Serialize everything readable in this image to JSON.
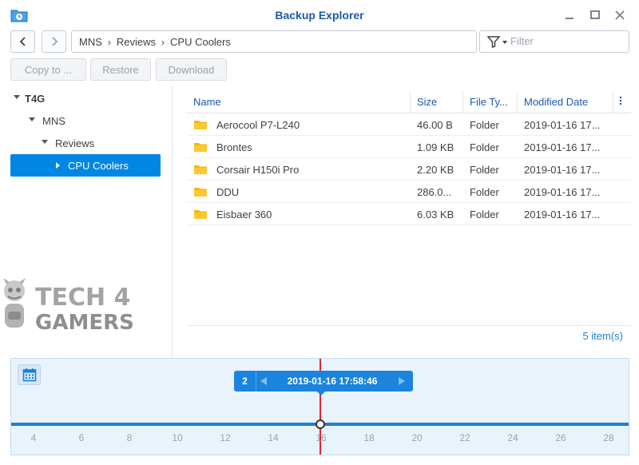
{
  "window": {
    "title": "Backup Explorer"
  },
  "colors": {
    "accent": "#0086e5",
    "title": "#1d5aa8",
    "cursor": "#e0242a",
    "folder": "#f5b70f"
  },
  "breadcrumb": [
    "MNS",
    "Reviews",
    "CPU Coolers"
  ],
  "filter": {
    "placeholder": "Filter"
  },
  "toolbar": {
    "copy_label": "Copy to ...",
    "restore_label": "Restore",
    "download_label": "Download"
  },
  "tree": [
    {
      "label": "T4G",
      "bold": true
    },
    {
      "label": "MNS"
    },
    {
      "label": "Reviews"
    },
    {
      "label": "CPU Coolers",
      "selected": true
    }
  ],
  "table": {
    "columns": [
      "Name",
      "Size",
      "File Ty...",
      "Modified Date"
    ],
    "rows": [
      {
        "name": "Aerocool P7-L240",
        "size": "46.00 B",
        "type": "Folder",
        "date": "2019-01-16 17..."
      },
      {
        "name": "Brontes",
        "size": "1.09 KB",
        "type": "Folder",
        "date": "2019-01-16 17..."
      },
      {
        "name": "Corsair H150i Pro",
        "size": "2.20 KB",
        "type": "Folder",
        "date": "2019-01-16 17..."
      },
      {
        "name": "DDU",
        "size": "286.0...",
        "type": "Folder",
        "date": "2019-01-16 17..."
      },
      {
        "name": "Eisbaer 360",
        "size": "6.03 KB",
        "type": "Folder",
        "date": "2019-01-16 17..."
      }
    ]
  },
  "status": {
    "items": "5 item(s)"
  },
  "timeline": {
    "version_count": "2",
    "current": "2019-01-16 17:58:46",
    "ticks": [
      "4",
      "6",
      "8",
      "10",
      "12",
      "14",
      "16",
      "18",
      "20",
      "22",
      "24",
      "26",
      "28"
    ]
  },
  "watermark": {
    "line1": "TECH 4",
    "line2": "GAMERS"
  }
}
